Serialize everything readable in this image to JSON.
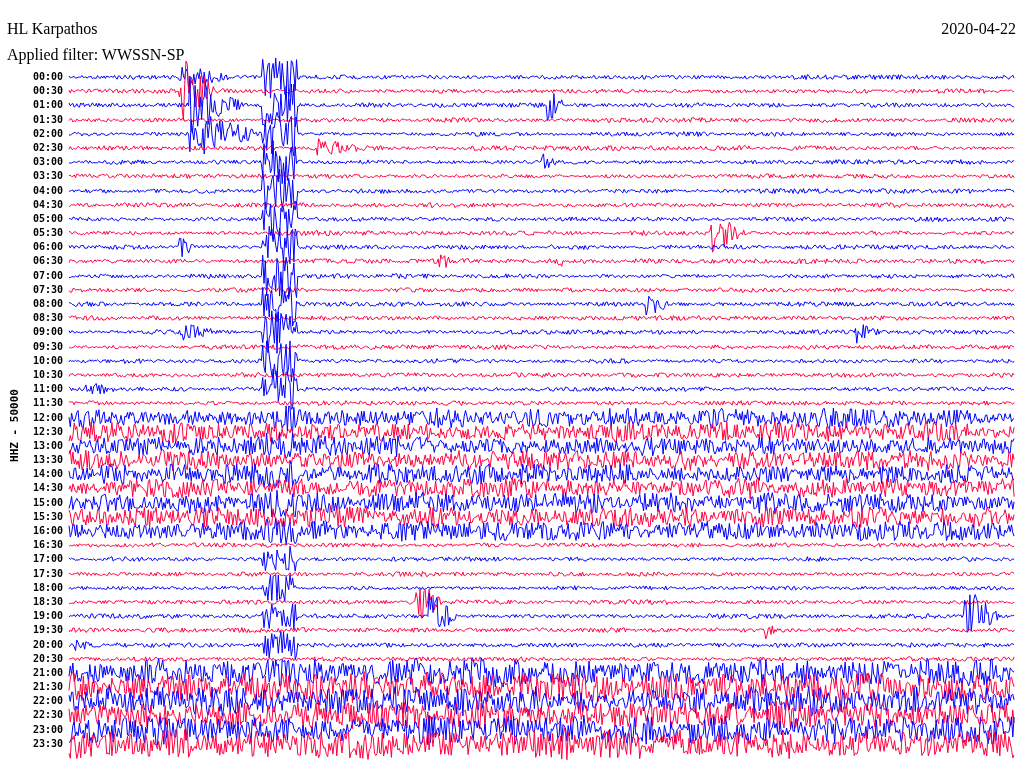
{
  "header": {
    "station": "HL Karpathos",
    "date": "2020-04-22",
    "filter": "Applied filter: WWSSN-SP"
  },
  "helicorder": {
    "channel_label": "HHZ - 50000",
    "rows": [
      {
        "time": "00:00",
        "color": "#0000ff"
      },
      {
        "time": "00:30",
        "color": "#ff0040"
      },
      {
        "time": "01:00",
        "color": "#0000ff"
      },
      {
        "time": "01:30",
        "color": "#ff0040"
      },
      {
        "time": "02:00",
        "color": "#0000ff"
      },
      {
        "time": "02:30",
        "color": "#ff0040"
      },
      {
        "time": "03:00",
        "color": "#0000ff"
      },
      {
        "time": "03:30",
        "color": "#ff0040"
      },
      {
        "time": "04:00",
        "color": "#0000ff"
      },
      {
        "time": "04:30",
        "color": "#ff0040"
      },
      {
        "time": "05:00",
        "color": "#0000ff"
      },
      {
        "time": "05:30",
        "color": "#ff0040"
      },
      {
        "time": "06:00",
        "color": "#0000ff"
      },
      {
        "time": "06:30",
        "color": "#ff0040"
      },
      {
        "time": "07:00",
        "color": "#0000ff"
      },
      {
        "time": "07:30",
        "color": "#ff0040"
      },
      {
        "time": "08:00",
        "color": "#0000ff"
      },
      {
        "time": "08:30",
        "color": "#ff0040"
      },
      {
        "time": "09:00",
        "color": "#0000ff"
      },
      {
        "time": "09:30",
        "color": "#ff0040"
      },
      {
        "time": "10:00",
        "color": "#0000ff"
      },
      {
        "time": "10:30",
        "color": "#ff0040"
      },
      {
        "time": "11:00",
        "color": "#0000ff"
      },
      {
        "time": "11:30",
        "color": "#ff0040"
      },
      {
        "time": "12:00",
        "color": "#0000ff"
      },
      {
        "time": "12:30",
        "color": "#ff0040"
      },
      {
        "time": "13:00",
        "color": "#0000ff"
      },
      {
        "time": "13:30",
        "color": "#ff0040"
      },
      {
        "time": "14:00",
        "color": "#0000ff"
      },
      {
        "time": "14:30",
        "color": "#ff0040"
      },
      {
        "time": "15:00",
        "color": "#0000ff"
      },
      {
        "time": "15:30",
        "color": "#ff0040"
      },
      {
        "time": "16:00",
        "color": "#0000ff"
      },
      {
        "time": "16:30",
        "color": "#ff0040"
      },
      {
        "time": "17:00",
        "color": "#0000ff"
      },
      {
        "time": "17:30",
        "color": "#ff0040"
      },
      {
        "time": "18:00",
        "color": "#0000ff"
      },
      {
        "time": "18:30",
        "color": "#ff0040"
      },
      {
        "time": "19:00",
        "color": "#0000ff"
      },
      {
        "time": "19:30",
        "color": "#ff0040"
      },
      {
        "time": "20:00",
        "color": "#0000ff"
      },
      {
        "time": "20:30",
        "color": "#ff0040"
      },
      {
        "time": "21:00",
        "color": "#0000ff"
      },
      {
        "time": "21:30",
        "color": "#ff0040"
      },
      {
        "time": "22:00",
        "color": "#0000ff"
      },
      {
        "time": "22:30",
        "color": "#ff0040"
      },
      {
        "time": "23:00",
        "color": "#0000ff"
      },
      {
        "time": "23:30",
        "color": "#ff0040"
      }
    ]
  }
}
